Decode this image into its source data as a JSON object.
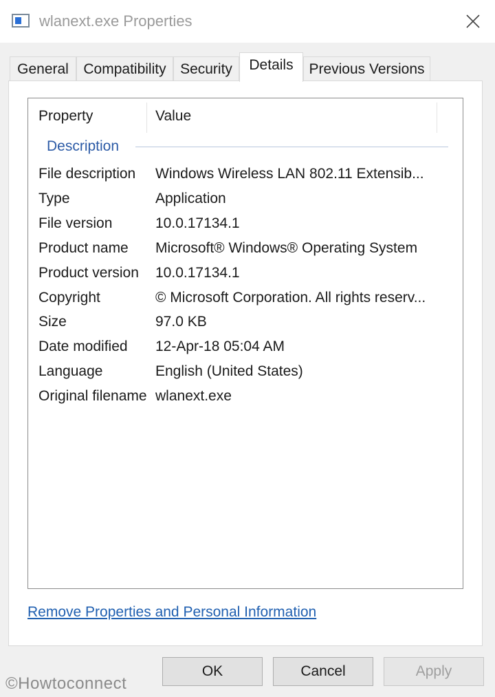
{
  "window": {
    "title": "wlanext.exe Properties",
    "app_icon": "application-window-icon",
    "close_icon": "close-icon"
  },
  "tabs": [
    {
      "label": "General",
      "active": false
    },
    {
      "label": "Compatibility",
      "active": false
    },
    {
      "label": "Security",
      "active": false
    },
    {
      "label": "Details",
      "active": true
    },
    {
      "label": "Previous Versions",
      "active": false
    }
  ],
  "details": {
    "columns": {
      "property": "Property",
      "value": "Value"
    },
    "group": "Description",
    "rows": [
      {
        "property": "File description",
        "value": "Windows Wireless LAN 802.11 Extensib..."
      },
      {
        "property": "Type",
        "value": "Application"
      },
      {
        "property": "File version",
        "value": "10.0.17134.1"
      },
      {
        "property": "Product name",
        "value": "Microsoft® Windows® Operating System"
      },
      {
        "property": "Product version",
        "value": "10.0.17134.1"
      },
      {
        "property": "Copyright",
        "value": "© Microsoft Corporation. All rights reserv..."
      },
      {
        "property": "Size",
        "value": "97.0 KB"
      },
      {
        "property": "Date modified",
        "value": "12-Apr-18 05:04 AM"
      },
      {
        "property": "Language",
        "value": "English (United States)"
      },
      {
        "property": "Original filename",
        "value": "wlanext.exe"
      }
    ]
  },
  "remove_link": "Remove Properties and Personal Information",
  "buttons": {
    "ok": "OK",
    "cancel": "Cancel",
    "apply": "Apply",
    "apply_enabled": false
  },
  "watermark": "©Howtoconnect",
  "colors": {
    "link": "#1f5fb0",
    "group_label": "#2b5aa6",
    "dialog_bg": "#f0f0f0"
  }
}
